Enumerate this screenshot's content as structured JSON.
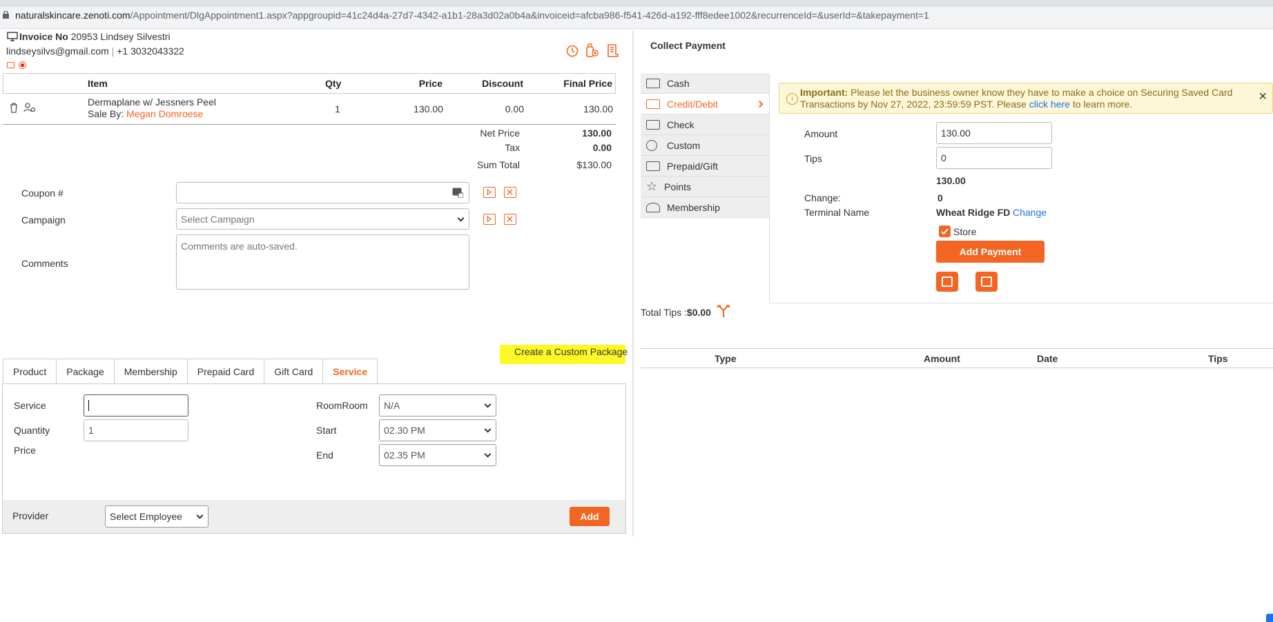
{
  "browser": {
    "url_domain": "naturalskincare.zenoti.com",
    "url_path": "/Appointment/DlgAppointment1.aspx?appgroupid=41c24d4a-27d7-4342-a1b1-28a3d02a0b4a&invoiceid=afcba986-f541-426d-a192-fff8edee1002&recurrenceId=&userId=&takepayment=1"
  },
  "invoice": {
    "label": "Invoice No",
    "number": "20953",
    "customer_name": "Lindsey Silvestri",
    "email": "lindseysilvs@gmail.com",
    "separator": "|",
    "phone": "+1 3032043322"
  },
  "items_table": {
    "headers": [
      "Item",
      "Qty",
      "Price",
      "Discount",
      "Final Price"
    ],
    "rows": [
      {
        "item": "Dermaplane w/ Jessners Peel",
        "sale_by_label": "Sale By:",
        "sale_by": "Megan Domroese",
        "qty": "1",
        "price": "130.00",
        "discount": "0.00",
        "final_price": "130.00"
      }
    ]
  },
  "totals": {
    "net_price_label": "Net Price",
    "net_price": "130.00",
    "tax_label": "Tax",
    "tax": "0.00",
    "sum_total_label": "Sum Total",
    "sum_total": "$130.00"
  },
  "form": {
    "coupon_label": "Coupon #",
    "campaign_label": "Campaign",
    "campaign_placeholder": "Select Campaign",
    "comments_label": "Comments",
    "comments_placeholder": "Comments are auto-saved."
  },
  "create_custom_package": "Create a Custom Package",
  "tabs": [
    "Product",
    "Package",
    "Membership",
    "Prepaid Card",
    "Gift Card",
    "Service"
  ],
  "active_tab": "Service",
  "service_form": {
    "service_label": "Service",
    "service_value": "",
    "quantity_label": "Quantity",
    "quantity_value": "1",
    "price_label": "Price",
    "room_label": "RoomRoom",
    "room_value": "N/A",
    "start_label": "Start",
    "start_value": "02.30 PM",
    "end_label": "End",
    "end_value": "02.35 PM",
    "provider_label": "Provider",
    "provider_placeholder": "Select Employee",
    "add_button": "Add"
  },
  "payment": {
    "title": "Collect Payment",
    "methods": [
      "Cash",
      "Credit/Debit",
      "Check",
      "Custom",
      "Prepaid/Gift",
      "Points",
      "Membership"
    ],
    "active_method": "Credit/Debit",
    "notice": {
      "strong": "Important:",
      "text1": " Please let the business owner know they have to make a choice on Securing Saved Card",
      "text2": "Transactions by Nov 27, 2022, 23:59:59 PST. Please ",
      "link": "click here",
      "text3": " to learn more."
    },
    "amount_label": "Amount",
    "amount_value": "130.00",
    "tips_label": "Tips",
    "tips_value": "0",
    "total_display": "130.00",
    "change_label": "Change:",
    "change_value": "0",
    "terminal_label": "Terminal Name",
    "terminal_value": "Wheat Ridge FD",
    "terminal_change_link": "Change",
    "store_label": "Store",
    "store_checked": true,
    "add_payment_button": "Add Payment",
    "total_tips_label": "Total Tips :",
    "total_tips_value": "$0.00",
    "table_headers": [
      "Type",
      "Amount",
      "Date",
      "Tips"
    ]
  },
  "colors": {
    "accent": "#f26522",
    "link": "#1a73e8",
    "highlight": "#fff827",
    "notice_bg": "#fdf7d7"
  }
}
